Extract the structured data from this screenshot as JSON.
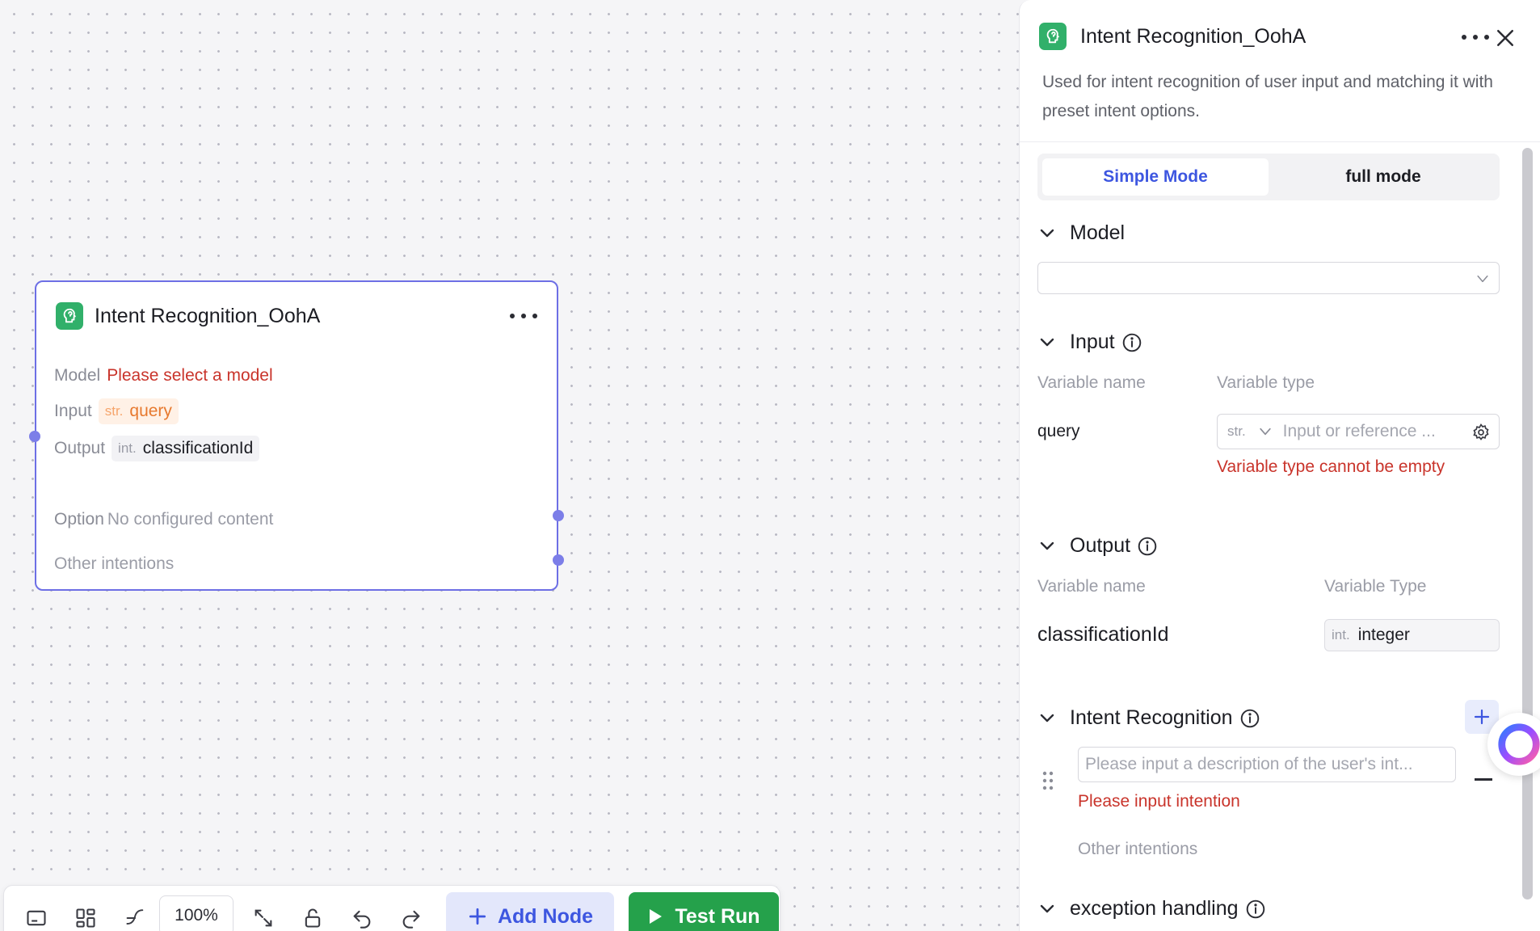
{
  "canvas_node": {
    "title": "Intent Recognition_OohA",
    "model_label": "Model",
    "model_value": "Please select a model",
    "input_label": "Input",
    "input_type": "str.",
    "input_value": "query",
    "output_label": "Output",
    "output_type": "int.",
    "output_value": "classificationId",
    "option_label": "Option",
    "option_value": "No configured content",
    "other_intentions": "Other intentions"
  },
  "toolbar": {
    "zoom": "100%",
    "add_node": "Add Node",
    "test_run": "Test Run"
  },
  "panel": {
    "title": "Intent Recognition_OohA",
    "description": "Used for intent recognition of user input and matching it with preset intent options.",
    "modes": {
      "simple": "Simple Mode",
      "full": "full mode"
    },
    "model": {
      "heading": "Model",
      "selected": ""
    },
    "input": {
      "heading": "Input",
      "col_name": "Variable name",
      "col_type": "Variable type",
      "var_name": "query",
      "type_tag": "str.",
      "placeholder": "Input or reference ...",
      "error": "Variable type cannot be empty"
    },
    "output": {
      "heading": "Output",
      "col_name": "Variable name",
      "col_type": "Variable Type",
      "var_name": "classificationId",
      "type_tag": "int.",
      "type_value": "integer"
    },
    "intent": {
      "heading": "Intent Recognition",
      "placeholder": "Please input a description of the user's int...",
      "error": "Please input intention",
      "other": "Other intentions"
    },
    "exception": {
      "heading": "exception handling"
    }
  },
  "colors": {
    "accent": "#3d56e0",
    "node_icon": "#31b06a",
    "error": "#c9342b",
    "run_button": "#25a14b",
    "node_border": "#6d6fe5"
  },
  "icons": [
    "brain-icon",
    "more-icon",
    "close-icon",
    "chevron-down-icon",
    "info-icon",
    "gear-icon",
    "plus-icon",
    "drag-handle-icon",
    "minus-icon",
    "play-icon",
    "assistant-logo-icon"
  ]
}
